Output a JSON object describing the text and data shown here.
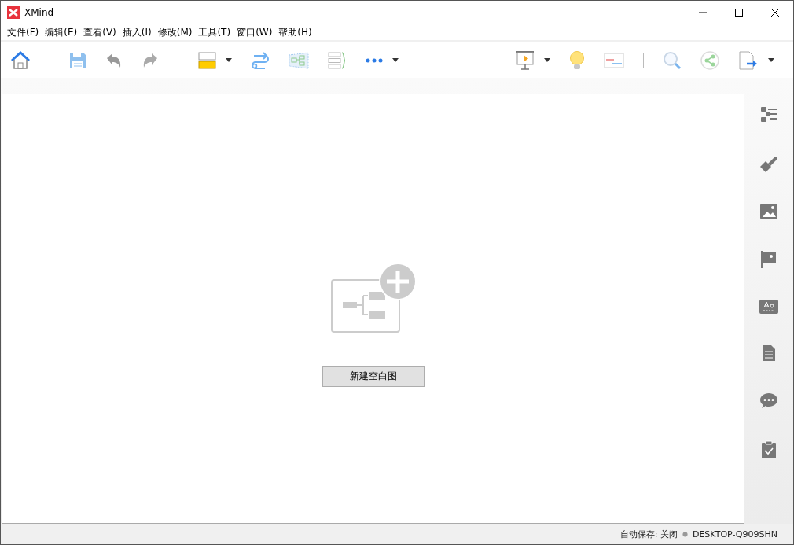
{
  "window": {
    "title": "XMind"
  },
  "menu": [
    "文件(F)",
    "编辑(E)",
    "查看(V)",
    "插入(I)",
    "修改(M)",
    "工具(T)",
    "窗口(W)",
    "帮助(H)"
  ],
  "canvas": {
    "new_button": "新建空白图"
  },
  "status_bar": {
    "autosave": "自动保存: 关闭",
    "computer": "DESKTOP-Q909SHN"
  }
}
